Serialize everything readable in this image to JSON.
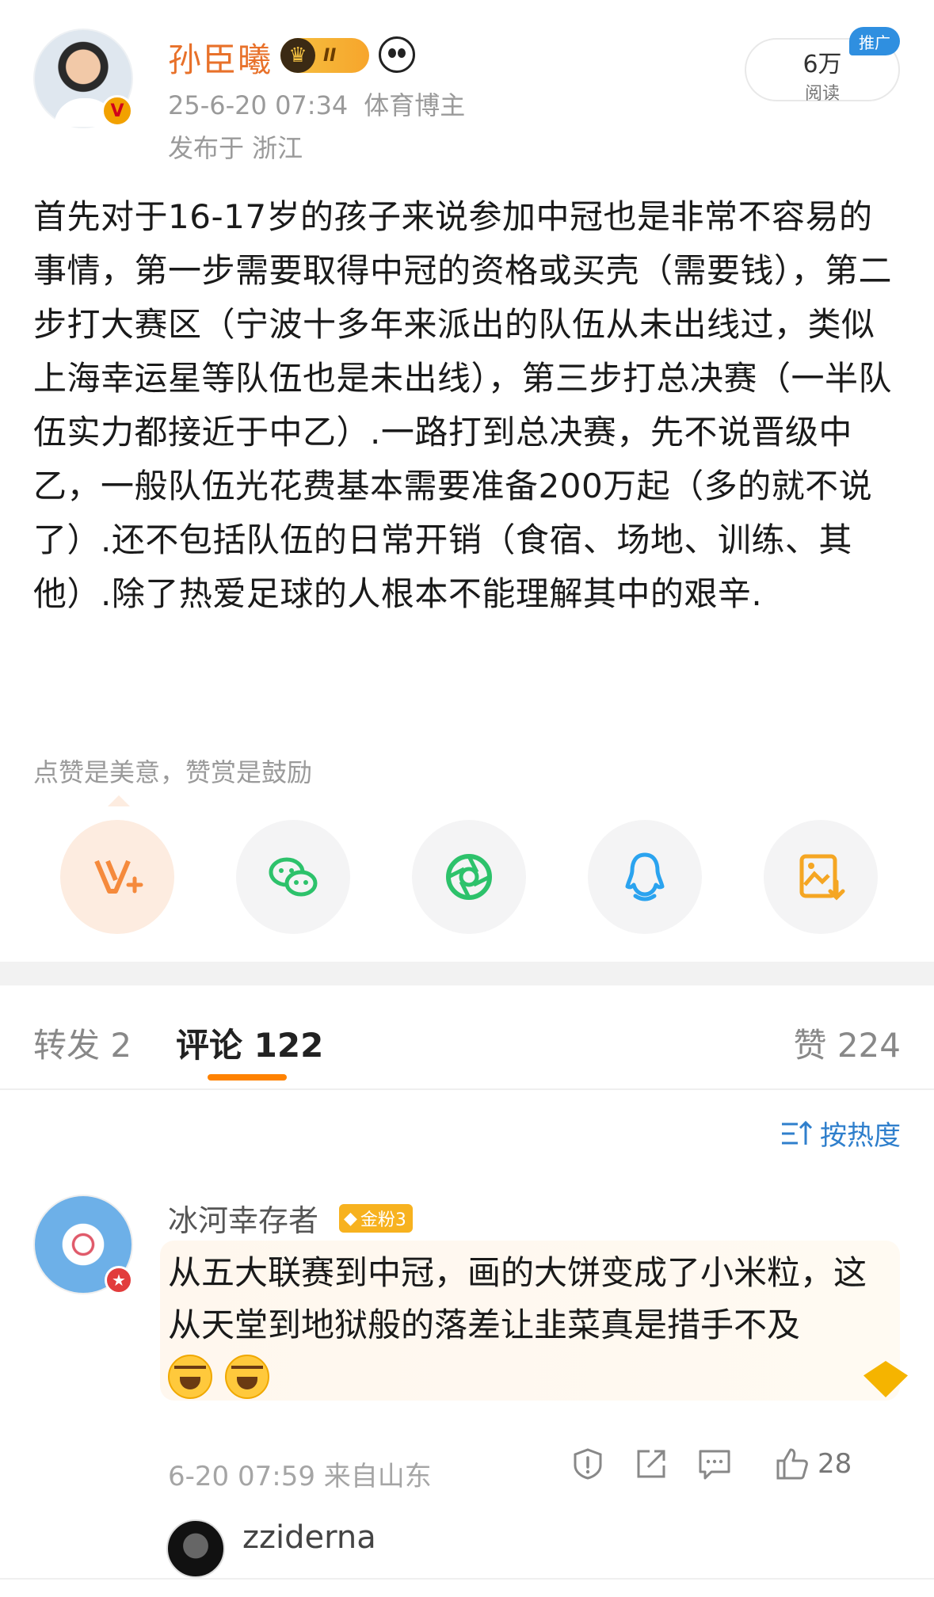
{
  "post": {
    "author": "孙臣曦",
    "level_badge": "II",
    "datetime": "25-6-20 07:34",
    "role": "体育博主",
    "location": "发布于 浙江",
    "reads_value": "6万",
    "reads_label": "阅读",
    "promo_tag": "推广",
    "text": "首先对于16-17岁的孩子来说参加中冠也是非常不容易的事情，第一步需要取得中冠的资格或买壳（需要钱），第二步打大赛区（宁波十多年来派出的队伍从未出线过，类似上海幸运星等队伍也是未出线），第三步打总决赛（一半队伍实力都接近于中乙）.一路打到总决赛，先不说晋级中乙，一般队伍光花费基本需要准备200万起（多的就不说了）.还不包括队伍的日常开销（食宿、场地、训练、其他）.除了热爱足球的人根本不能理解其中的艰辛."
  },
  "reward": {
    "tip": "点赞是美意，赞赏是鼓励"
  },
  "share": {
    "icons": [
      "reward-icon",
      "wechat-icon",
      "moments-icon",
      "qq-icon",
      "save-image-icon"
    ],
    "colors": {
      "reward": "#f58a3c",
      "wechat": "#2dc26b",
      "moments": "#2dc26b",
      "qq": "#2aa3ef",
      "save": "#f5a623"
    }
  },
  "tabs": {
    "repost": "转发 2",
    "comment": "评论 122",
    "like": "赞 224",
    "accent": "#ff8200"
  },
  "sort": {
    "label": "按热度"
  },
  "comment": {
    "author": "冰河幸存者",
    "fan_badge": "金粉3",
    "text": "从五大联赛到中冠，画的大饼变成了小米粒，这从天堂到地狱般的落差让韭菜真是措手不及",
    "emojis": [
      "laugh-cry-emoji",
      "grin-sweat-emoji"
    ],
    "datetime": "6-20 07:59",
    "source": "来自山东",
    "like_count": "28"
  },
  "sub_comment": {
    "author": "zziderna"
  }
}
